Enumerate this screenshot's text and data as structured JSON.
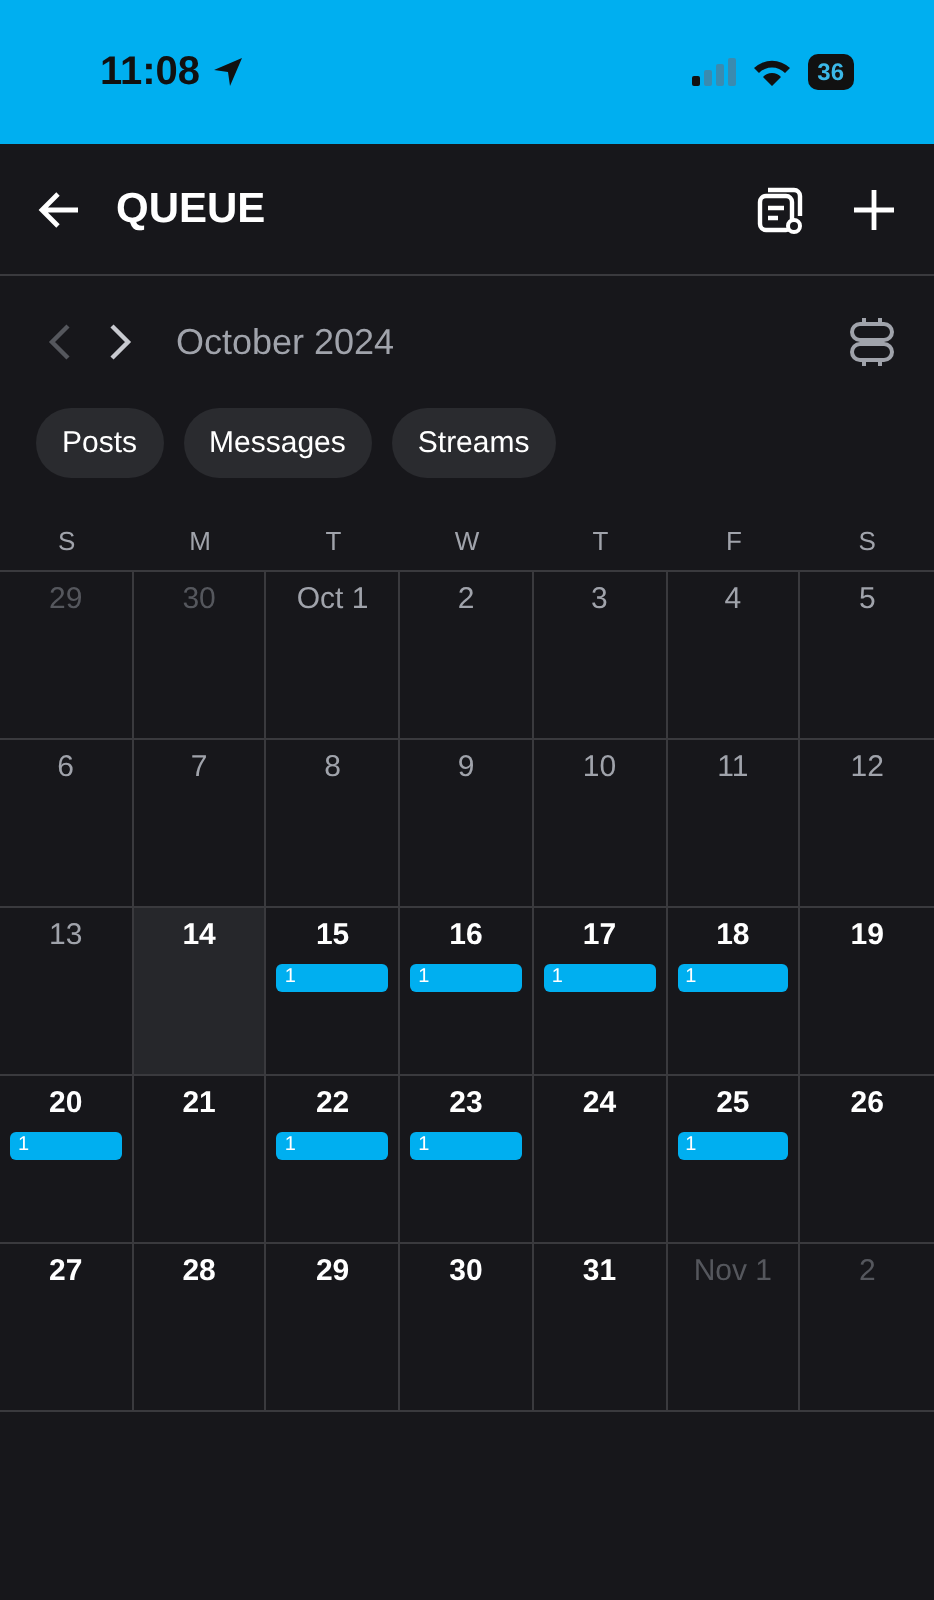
{
  "status_bar": {
    "time": "11:08",
    "battery": "36"
  },
  "header": {
    "title": "QUEUE"
  },
  "month_nav": {
    "label": "October 2024",
    "prev_disabled": true
  },
  "filters": [
    {
      "label": "Posts",
      "selected": false
    },
    {
      "label": "Messages",
      "selected": false
    },
    {
      "label": "Streams",
      "selected": false
    }
  ],
  "weekdays": [
    "S",
    "M",
    "T",
    "W",
    "T",
    "F",
    "S"
  ],
  "weeks": [
    [
      {
        "label": "29",
        "kind": "outside"
      },
      {
        "label": "30",
        "kind": "outside"
      },
      {
        "label": "Oct 1",
        "kind": "past"
      },
      {
        "label": "2",
        "kind": "past"
      },
      {
        "label": "3",
        "kind": "past"
      },
      {
        "label": "4",
        "kind": "past"
      },
      {
        "label": "5",
        "kind": "past"
      }
    ],
    [
      {
        "label": "6",
        "kind": "past"
      },
      {
        "label": "7",
        "kind": "past"
      },
      {
        "label": "8",
        "kind": "past"
      },
      {
        "label": "9",
        "kind": "past"
      },
      {
        "label": "10",
        "kind": "past"
      },
      {
        "label": "11",
        "kind": "past"
      },
      {
        "label": "12",
        "kind": "past"
      }
    ],
    [
      {
        "label": "13",
        "kind": "past"
      },
      {
        "label": "14",
        "kind": "today"
      },
      {
        "label": "15",
        "kind": "future",
        "event": "1"
      },
      {
        "label": "16",
        "kind": "future",
        "event": "1"
      },
      {
        "label": "17",
        "kind": "future",
        "event": "1"
      },
      {
        "label": "18",
        "kind": "future",
        "event": "1"
      },
      {
        "label": "19",
        "kind": "future"
      }
    ],
    [
      {
        "label": "20",
        "kind": "future",
        "event": "1"
      },
      {
        "label": "21",
        "kind": "future"
      },
      {
        "label": "22",
        "kind": "future",
        "event": "1"
      },
      {
        "label": "23",
        "kind": "future",
        "event": "1"
      },
      {
        "label": "24",
        "kind": "future"
      },
      {
        "label": "25",
        "kind": "future",
        "event": "1"
      },
      {
        "label": "26",
        "kind": "future"
      }
    ],
    [
      {
        "label": "27",
        "kind": "future"
      },
      {
        "label": "28",
        "kind": "future"
      },
      {
        "label": "29",
        "kind": "future"
      },
      {
        "label": "30",
        "kind": "future"
      },
      {
        "label": "31",
        "kind": "future"
      },
      {
        "label": "Nov 1",
        "kind": "outside"
      },
      {
        "label": "2",
        "kind": "outside"
      }
    ]
  ]
}
